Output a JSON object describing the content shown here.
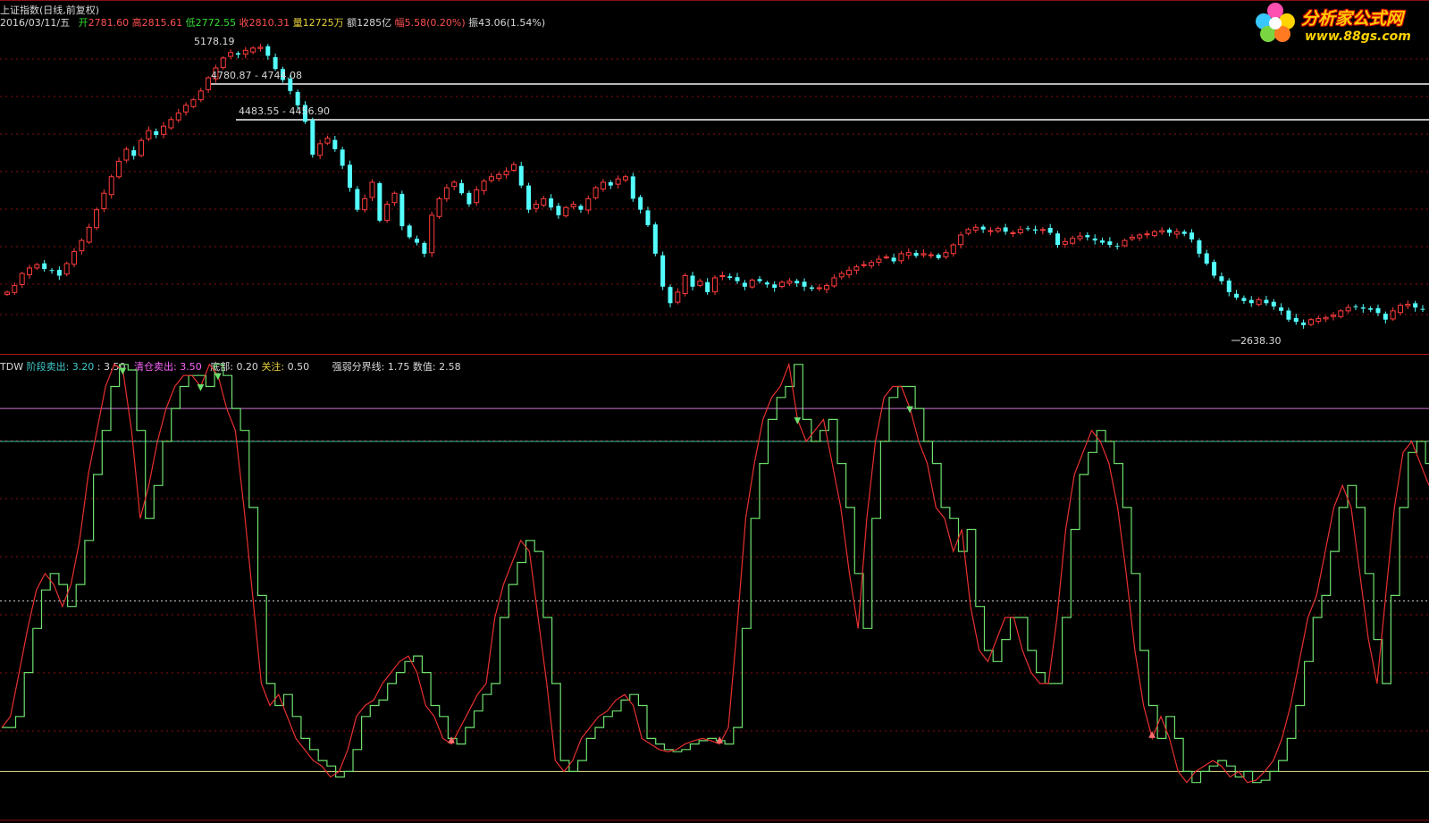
{
  "header": {
    "title": "上证指数(日线,前复权)"
  },
  "quote": {
    "date": "2016/03/11/五",
    "open_label": "开",
    "open": "2781.60",
    "high_label": "高",
    "high": "2815.61",
    "low_label": "低",
    "low": "2772.55",
    "close_label": "收",
    "close": "2810.31",
    "vol_label": "量",
    "vol": "12725万",
    "amt_label": "额",
    "amt": "1285亿",
    "chg_label": "幅",
    "chg": "5.58(0.20%)",
    "amp_label": "振",
    "amp": "43.06(1.54%)"
  },
  "logo": {
    "brand": "分析家公式网",
    "url": "www.88gs.com"
  },
  "annotations": {
    "peak": "5178.19",
    "gap1": "4780.87 - 4744.08",
    "gap2": "4483.55 - 4456.90",
    "low": "2638.30"
  },
  "indicator": {
    "name": "TDW",
    "stage_sell_label": "阶段卖出:",
    "stage_sell_v1": "3.20",
    "stage_sell_v2": ": 3.50",
    "clear_sell_label": "清仓卖出:",
    "clear_sell_v": "3.50",
    "bottom_label": "底部:",
    "bottom_v": "0.20",
    "watch_label": "关注:",
    "watch_v": "0.50",
    "divider_label": "强弱分界线:",
    "divider_v": "1.75",
    "value_label": "数值:",
    "value_v": "2.58"
  },
  "colors": {
    "up": "#ff3c3c",
    "down": "#54ffff",
    "bg": "#000000",
    "grid": "#8a1010",
    "ind_red": "#e83030",
    "ind_green": "#6ee06e",
    "clear_line": "#d070d0",
    "stage_line": "#40c0a0",
    "bottom_line": "#e8e890"
  },
  "chart_data": [
    {
      "type": "candlestick",
      "title": "上证指数(日线,前复权)",
      "ylim": [
        2600,
        5250
      ],
      "closes": [
        2950,
        3010,
        3120,
        3170,
        3200,
        3160,
        3150,
        3100,
        3210,
        3320,
        3420,
        3540,
        3700,
        3850,
        4000,
        4140,
        4250,
        4190,
        4330,
        4420,
        4380,
        4460,
        4520,
        4580,
        4650,
        4700,
        4780,
        4900,
        4990,
        5080,
        5130,
        5110,
        5150,
        5170,
        5178,
        5100,
        4980,
        4880,
        4780,
        4650,
        4500,
        4200,
        4300,
        4350,
        4250,
        4100,
        3900,
        3700,
        3800,
        3950,
        3600,
        3750,
        3850,
        3550,
        3450,
        3400,
        3300,
        3650,
        3800,
        3900,
        3950,
        3850,
        3750,
        3880,
        3960,
        4000,
        4020,
        4050,
        4110,
        3920,
        3700,
        3750,
        3800,
        3720,
        3650,
        3720,
        3750,
        3700,
        3800,
        3900,
        3950,
        3920,
        3980,
        4000,
        3800,
        3700,
        3560,
        3300,
        3000,
        2850,
        2950,
        3100,
        3000,
        3050,
        2950,
        3080,
        3100,
        3080,
        3050,
        3000,
        3060,
        3050,
        3020,
        2990,
        3040,
        3050,
        3030,
        3000,
        2980,
        2990,
        3010,
        3080,
        3120,
        3150,
        3180,
        3200,
        3220,
        3250,
        3270,
        3230,
        3300,
        3310,
        3280,
        3300,
        3290,
        3260,
        3310,
        3380,
        3470,
        3520,
        3540,
        3520,
        3510,
        3530,
        3500,
        3490,
        3520,
        3530,
        3510,
        3520,
        3490,
        3380,
        3410,
        3440,
        3460,
        3450,
        3420,
        3400,
        3380,
        3370,
        3420,
        3450,
        3470,
        3480,
        3500,
        3510,
        3490,
        3500,
        3480,
        3430,
        3300,
        3210,
        3100,
        3050,
        2950,
        2900,
        2870,
        2850,
        2880,
        2850,
        2820,
        2780,
        2700,
        2680,
        2650,
        2700,
        2710,
        2720,
        2740,
        2780,
        2810,
        2820,
        2800,
        2790,
        2760,
        2700,
        2780,
        2830,
        2840,
        2810,
        2790
      ]
    },
    {
      "type": "line",
      "title": "TDW",
      "ylim": [
        0,
        3.85
      ],
      "reference_lines": {
        "stage_sell": 3.2,
        "clear_sell": 3.5,
        "bottom": 0.2,
        "watch": 0.5,
        "divider": 1.75
      },
      "values": [
        0.6,
        0.7,
        1.1,
        1.5,
        1.85,
        2.0,
        1.9,
        1.7,
        1.9,
        2.3,
        2.9,
        3.3,
        3.7,
        3.9,
        3.85,
        3.3,
        2.5,
        2.8,
        3.2,
        3.5,
        3.7,
        3.8,
        3.8,
        3.7,
        3.9,
        3.8,
        3.5,
        3.3,
        2.6,
        1.8,
        1.0,
        0.8,
        0.9,
        0.7,
        0.5,
        0.4,
        0.3,
        0.25,
        0.15,
        0.2,
        0.4,
        0.7,
        0.8,
        0.85,
        1.0,
        1.1,
        1.2,
        1.25,
        1.1,
        0.8,
        0.7,
        0.5,
        0.45,
        0.6,
        0.75,
        0.9,
        1.0,
        1.6,
        1.9,
        2.1,
        2.3,
        2.2,
        1.6,
        1.0,
        0.3,
        0.2,
        0.3,
        0.5,
        0.6,
        0.7,
        0.75,
        0.85,
        0.9,
        0.8,
        0.5,
        0.45,
        0.4,
        0.38,
        0.4,
        0.45,
        0.48,
        0.5,
        0.48,
        0.45,
        0.6,
        1.5,
        2.5,
        3.0,
        3.4,
        3.6,
        3.7,
        3.9,
        3.4,
        3.2,
        3.3,
        3.4,
        3.0,
        2.6,
        2.0,
        1.5,
        2.5,
        3.2,
        3.6,
        3.7,
        3.7,
        3.5,
        3.2,
        3.0,
        2.6,
        2.5,
        2.2,
        2.4,
        1.7,
        1.3,
        1.2,
        1.4,
        1.6,
        1.6,
        1.3,
        1.1,
        1.0,
        1.0,
        1.6,
        2.4,
        2.9,
        3.1,
        3.3,
        3.2,
        3.0,
        2.6,
        2.0,
        1.3,
        0.8,
        0.5,
        0.7,
        0.5,
        0.2,
        0.1,
        0.2,
        0.25,
        0.3,
        0.25,
        0.15,
        0.2,
        0.1,
        0.12,
        0.2,
        0.3,
        0.5,
        0.8,
        1.2,
        1.6,
        1.8,
        2.2,
        2.6,
        2.8,
        2.6,
        2.0,
        1.4,
        1.0,
        1.8,
        2.6,
        3.1,
        3.2,
        3.0,
        2.8
      ]
    }
  ]
}
